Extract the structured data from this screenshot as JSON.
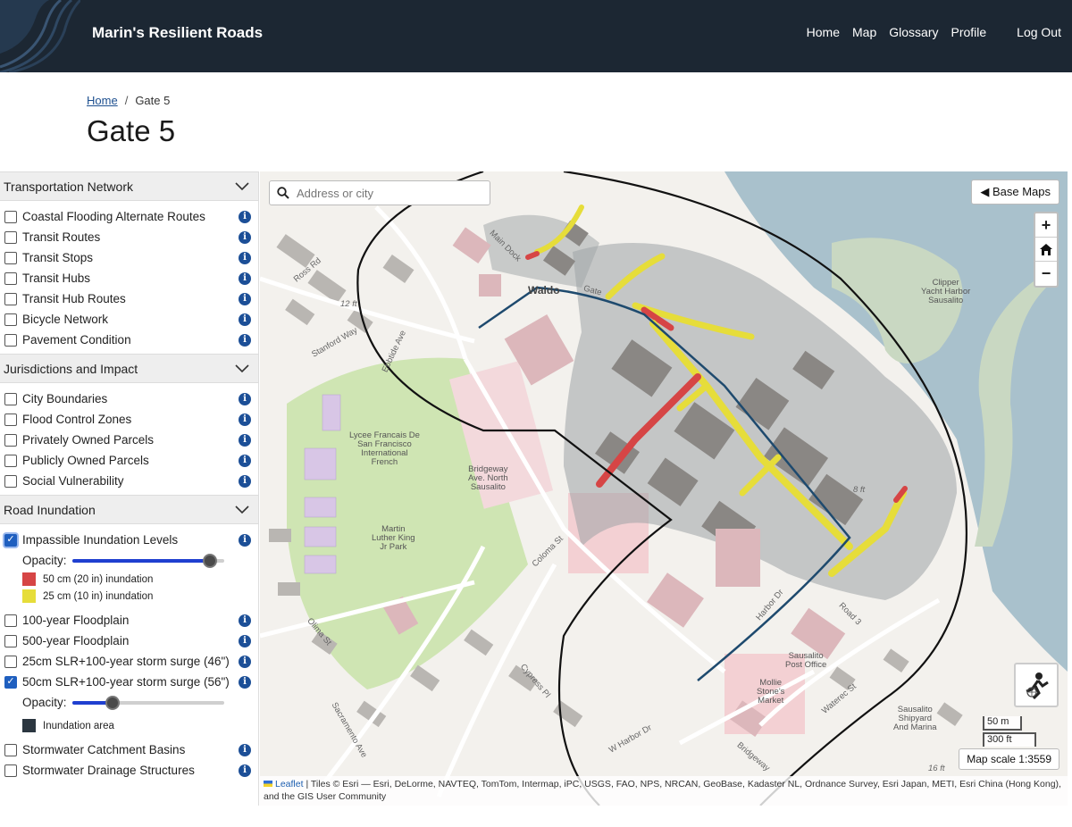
{
  "header": {
    "brand": "Marin's Resilient Roads",
    "nav": [
      "Home",
      "Map",
      "Glossary",
      "Profile",
      "Log Out"
    ]
  },
  "breadcrumb": {
    "home": "Home",
    "separator": "/",
    "current": "Gate 5"
  },
  "page_title": "Gate 5",
  "sidebar": {
    "sections": [
      {
        "title": "Transportation Network",
        "layers": [
          {
            "label": "Coastal Flooding Alternate Routes",
            "checked": false
          },
          {
            "label": "Transit Routes",
            "checked": false
          },
          {
            "label": "Transit Stops",
            "checked": false
          },
          {
            "label": "Transit Hubs",
            "checked": false
          },
          {
            "label": "Transit Hub Routes",
            "checked": false
          },
          {
            "label": "Bicycle Network",
            "checked": false
          },
          {
            "label": "Pavement Condition",
            "checked": false
          }
        ]
      },
      {
        "title": "Jurisdictions and Impact",
        "layers": [
          {
            "label": "City Boundaries",
            "checked": false
          },
          {
            "label": "Flood Control Zones",
            "checked": false
          },
          {
            "label": "Privately Owned Parcels",
            "checked": false
          },
          {
            "label": "Publicly Owned Parcels",
            "checked": false
          },
          {
            "label": "Social Vulnerability",
            "checked": false
          }
        ]
      },
      {
        "title": "Road Inundation",
        "layers": [
          {
            "label": "Impassible Inundation Levels",
            "checked": true
          },
          {
            "label": "100-year Floodplain",
            "checked": false
          },
          {
            "label": "500-year Floodplain",
            "checked": false
          },
          {
            "label": "25cm SLR+100-year storm surge (46\")",
            "checked": false
          },
          {
            "label": "50cm SLR+100-year storm surge (56\")",
            "checked": true
          },
          {
            "label": "Stormwater Catchment Basins",
            "checked": false
          },
          {
            "label": "Stormwater Drainage Structures",
            "checked": false
          }
        ]
      }
    ],
    "opacity_label": "Opacity:",
    "impassible_opacity": 0.95,
    "surge_opacity": 0.24,
    "legend_impassible": [
      {
        "label": "50 cm (20 in) inundation",
        "color": "#d64545"
      },
      {
        "label": "25 cm (10 in) inundation",
        "color": "#e6dd3a"
      }
    ],
    "legend_surge": [
      {
        "label": "Inundation area",
        "color": "#2b3640"
      }
    ],
    "info_icon": "i"
  },
  "map": {
    "search_placeholder": "Address or city",
    "base_maps": "◀ Base Maps",
    "zoom_in": "+",
    "zoom_out": "−",
    "scale_metric": "50 m",
    "scale_imperial": "300 ft",
    "map_scale": "Map scale 1:3559",
    "attribution_link": "Leaflet",
    "attribution_text": "| Tiles © Esri — Esri, DeLorme, NAVTEQ, TomTom, Intermap, iPC, USGS, FAO, NPS, NRCAN, GeoBase, Kadaster NL, Ordnance Survey, Esri Japan, METI, Esri China (Hong Kong), and the GIS User Community",
    "labels": {
      "clipper": "Clipper\nYacht Harbor\nSausalito",
      "lycee": "Lycee Francais De\nSan Francisco\nInternational\nFrench",
      "bridgeway": "Bridgeway\nAve. North\nSausalito",
      "mlk": "Martin\nLuther King\nJr Park",
      "post_office": "Sausalito\nPost Office",
      "mollie": "Mollie\nStone's\nMarket",
      "shipyard": "Sausalito\nShipyard\nAnd Marina",
      "waldo": "Waldo",
      "gate": "Gate",
      "main_dock": "Main Dock",
      "ross_rd": "Ross Rd",
      "stanford_way": "Stanford Way",
      "ebbtide": "Ebbtide Ave",
      "coloma": "Coloma St",
      "harbor_dr": "Harbor Dr",
      "road3": "Road 3",
      "olima": "Olima St",
      "cypress": "Cypress Pl",
      "sacramento": "Sacramento Ave",
      "w_harbor": "W Harbor Dr",
      "bridgeway_st": "Bridgeway",
      "waterec": "Waterec St",
      "ft12": "12 ft",
      "ft8": "8 ft",
      "ft16": "16 ft"
    }
  }
}
